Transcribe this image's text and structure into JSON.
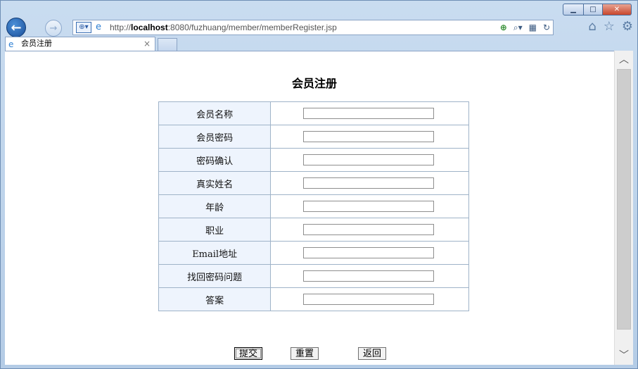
{
  "browser": {
    "url_prefix": "http://",
    "url_host": "localhost",
    "url_rest": ":8080/fuzhuang/member/memberRegister.jsp",
    "tab_title": "会员注册",
    "tab_close": "×"
  },
  "icons": {
    "back": "back-arrow-icon",
    "forward": "forward-arrow-icon",
    "compat": "compatibility-view-icon",
    "ie": "ie-logo-icon",
    "search": "search-icon",
    "refresh": "refresh-icon",
    "home": "home-icon",
    "favorites": "star-icon",
    "settings": "gear-icon"
  },
  "page": {
    "title": "会员注册",
    "fields": [
      {
        "label": "会员名称",
        "value": ""
      },
      {
        "label": "会员密码",
        "value": ""
      },
      {
        "label": "密码确认",
        "value": ""
      },
      {
        "label": "真实姓名",
        "value": ""
      },
      {
        "label": "年龄",
        "value": ""
      },
      {
        "label": "职业",
        "value": ""
      },
      {
        "label": "Email地址",
        "value": ""
      },
      {
        "label": "找回密码问题",
        "value": ""
      },
      {
        "label": "答案",
        "value": ""
      }
    ],
    "buttons": {
      "submit": "提交",
      "reset": "重置",
      "back": "返回"
    }
  },
  "colors": {
    "label_cell_bg": "#eef4fd",
    "table_border": "#9fb3c8"
  }
}
